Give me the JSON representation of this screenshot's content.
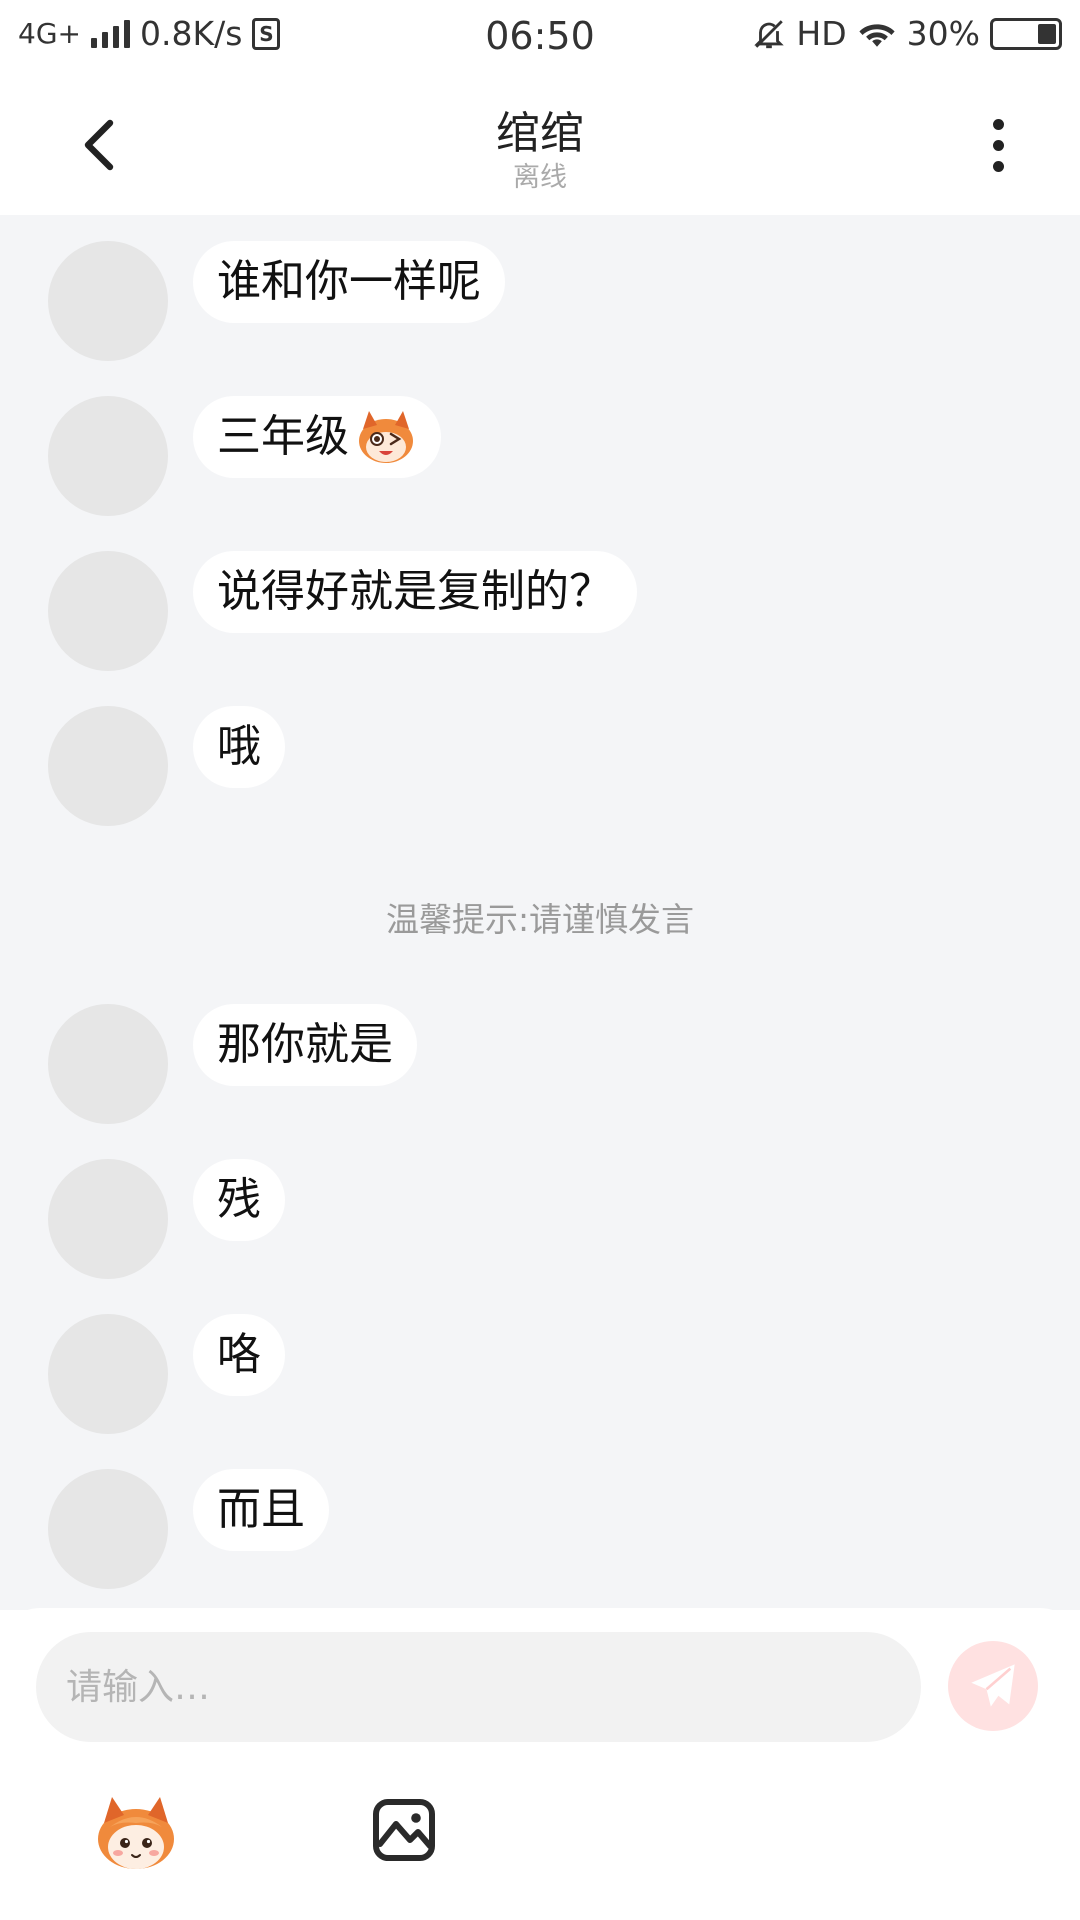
{
  "status_bar": {
    "network": "4G+",
    "speed": "0.8K/s",
    "sim_label": "S",
    "time": "06:50",
    "hd": "HD",
    "battery": "30%",
    "battery_level": 0.3
  },
  "header": {
    "title": "绾绾",
    "status": "离线",
    "back_icon": "chevron-left-icon",
    "more_icon": "more-vertical-icon"
  },
  "messages": [
    {
      "text": "谁和你一样呢"
    },
    {
      "text": "三年级",
      "sticker": "fox-wink-sticker"
    },
    {
      "text": "说得好就是复制的？"
    },
    {
      "text": "哦"
    },
    {
      "text": "那你就是"
    },
    {
      "text": "残"
    },
    {
      "text": "咯"
    },
    {
      "text": "而且"
    }
  ],
  "tip": "温馨提示:请谨慎发言",
  "composer": {
    "placeholder": "请输入…",
    "send_icon": "paper-plane-icon",
    "emoji_icon": "fox-emoji-icon",
    "image_icon": "image-icon"
  },
  "colors": {
    "chat_bg": "#f4f5f7",
    "send_bg": "#ffe1e1",
    "send_icon": "#ffffff",
    "tip_text": "#9a9a9a"
  }
}
